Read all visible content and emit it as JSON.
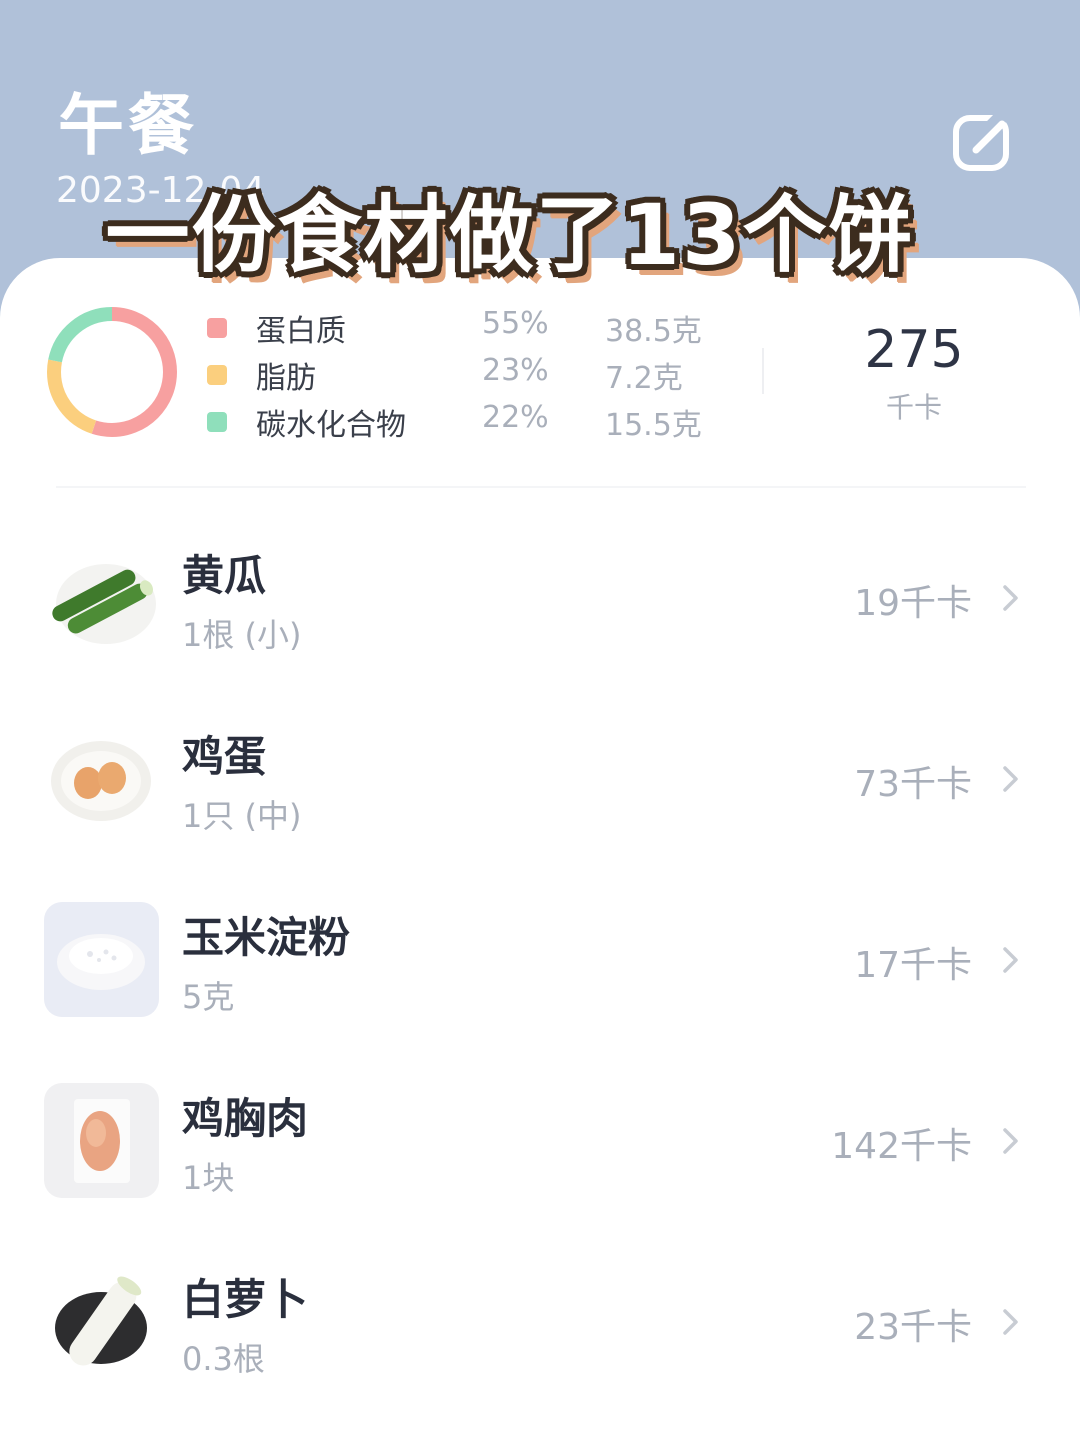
{
  "header": {
    "title": "午餐",
    "date": "2023-12-04",
    "edit_icon": "edit-icon",
    "bg_color": "#b0c1d9"
  },
  "overlay": {
    "caption": "一份食材做了13个饼"
  },
  "summary": {
    "donut_icon": "macro-donut-chart",
    "macros": [
      {
        "name": "蛋白质",
        "percent": "55%",
        "amount": "38.5克",
        "share": 0.55,
        "color": "#f7a0a0"
      },
      {
        "name": "脂肪",
        "percent": "23%",
        "amount": "7.2克",
        "share": 0.23,
        "color": "#fbcf7e"
      },
      {
        "name": "碳水化合物",
        "percent": "22%",
        "amount": "15.5克",
        "share": 0.22,
        "color": "#8fdfbb"
      }
    ],
    "total_kcal": "275",
    "kcal_unit": "千卡"
  },
  "foods": [
    {
      "name": "黄瓜",
      "portion": "1根 (小)",
      "kcal": "19千卡",
      "icon": "cucumber-image"
    },
    {
      "name": "鸡蛋",
      "portion": "1只 (中)",
      "kcal": "73千卡",
      "icon": "eggs-image"
    },
    {
      "name": "玉米淀粉",
      "portion": "5克",
      "kcal": "17千卡",
      "icon": "cornstarch-image"
    },
    {
      "name": "鸡胸肉",
      "portion": "1块",
      "kcal": "142千卡",
      "icon": "chicken-breast-image"
    },
    {
      "name": "白萝卜",
      "portion": "0.3根",
      "kcal": "23千卡",
      "icon": "white-radish-image"
    }
  ]
}
